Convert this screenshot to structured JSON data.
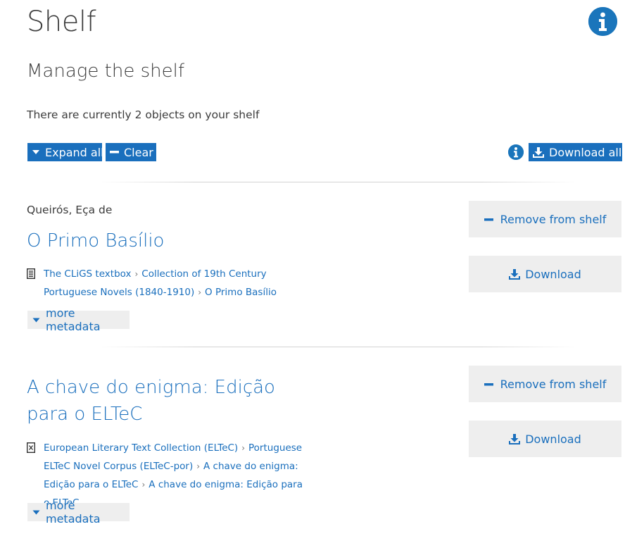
{
  "page": {
    "title": "Shelf",
    "subtitle": "Manage the shelf",
    "object_count_text": "There are currently 2 objects on your shelf"
  },
  "toolbar": {
    "expand_all_label": "Expand all",
    "clear_label": "Clear",
    "download_all_label": "Download all"
  },
  "icons": {
    "info": "info-icon",
    "caret": "caret-down-icon",
    "minus": "minus-icon",
    "download": "download-icon",
    "document": "document-icon",
    "xml_document": "xml-document-icon"
  },
  "colors": {
    "accent": "#1a6fbd",
    "button_gray": "#eeeeee",
    "text": "#3c3c3c"
  },
  "items": [
    {
      "author": "Queirós, Eça de",
      "title": "O Primo Basílio",
      "breadcrumbs": [
        "The CLiGS textbox",
        "Collection of 19th Century Portuguese Novels (1840-1910)",
        "O Primo Basílio"
      ],
      "more_metadata_label": "more metadata",
      "remove_label": "Remove from shelf",
      "download_label": "Download"
    },
    {
      "author": "",
      "title": "A chave do enigma: Edição para o ELTeC",
      "breadcrumbs": [
        "European Literary Text Collection (ELTeC)",
        "Portuguese ELTeC Novel Corpus (ELTeC-por)",
        "A chave do enigma: Edição para o ELTeC",
        "A chave do enigma: Edição para o ELTeC"
      ],
      "more_metadata_label": "more metadata",
      "remove_label": "Remove from shelf",
      "download_label": "Download"
    }
  ]
}
